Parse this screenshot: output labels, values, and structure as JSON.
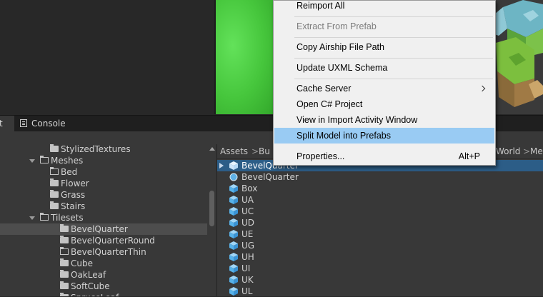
{
  "tabs": {
    "project_partial": "t",
    "console": "Console"
  },
  "tree": {
    "rows": [
      {
        "label": "StylizedTextures",
        "indent": 70,
        "folder": "filled",
        "expanded": false,
        "selected": false
      },
      {
        "label": "Meshes",
        "indent": 56,
        "folder": "open",
        "expanded": true,
        "selected": false
      },
      {
        "label": "Bed",
        "indent": 70,
        "folder": "outline",
        "expanded": false,
        "selected": false
      },
      {
        "label": "Flower",
        "indent": 70,
        "folder": "filled",
        "expanded": false,
        "selected": false
      },
      {
        "label": "Grass",
        "indent": 70,
        "folder": "filled",
        "expanded": false,
        "selected": false
      },
      {
        "label": "Stairs",
        "indent": 70,
        "folder": "filled",
        "expanded": false,
        "selected": false
      },
      {
        "label": "Tilesets",
        "indent": 56,
        "folder": "open",
        "expanded": true,
        "selected": false
      },
      {
        "label": "BevelQuarter",
        "indent": 84,
        "folder": "filled",
        "expanded": false,
        "selected": true
      },
      {
        "label": "BevelQuarterRound",
        "indent": 84,
        "folder": "filled",
        "expanded": false,
        "selected": false
      },
      {
        "label": "BevelQuarterThin",
        "indent": 84,
        "folder": "outline",
        "expanded": false,
        "selected": false
      },
      {
        "label": "Cube",
        "indent": 84,
        "folder": "filled",
        "expanded": false,
        "selected": false
      },
      {
        "label": "OakLeaf",
        "indent": 84,
        "folder": "filled",
        "expanded": false,
        "selected": false
      },
      {
        "label": "SoftCube",
        "indent": 84,
        "folder": "filled",
        "expanded": false,
        "selected": false
      },
      {
        "label": "SpruceLeaf",
        "indent": 84,
        "folder": "filled",
        "expanded": false,
        "selected": false
      }
    ]
  },
  "breadcrumb": {
    "items": [
      "Assets",
      "Bu",
      "World",
      "Me"
    ]
  },
  "assets": {
    "rows": [
      {
        "label": "BevelQuarter",
        "icon": "prefab-cube-icon",
        "selected": true
      },
      {
        "label": "BevelQuarter",
        "icon": "mesh-sphere-icon",
        "selected": false
      },
      {
        "label": "Box",
        "icon": "cube-icon",
        "selected": false
      },
      {
        "label": "UA",
        "icon": "cube-icon",
        "selected": false
      },
      {
        "label": "UC",
        "icon": "cube-icon",
        "selected": false
      },
      {
        "label": "UD",
        "icon": "cube-icon",
        "selected": false
      },
      {
        "label": "UE",
        "icon": "cube-icon",
        "selected": false
      },
      {
        "label": "UG",
        "icon": "cube-icon",
        "selected": false
      },
      {
        "label": "UH",
        "icon": "cube-icon",
        "selected": false
      },
      {
        "label": "UI",
        "icon": "cube-icon",
        "selected": false
      },
      {
        "label": "UK",
        "icon": "cube-icon",
        "selected": false
      },
      {
        "label": "UL",
        "icon": "cube-icon",
        "selected": false
      }
    ]
  },
  "context_menu": {
    "items": [
      {
        "label": "Reimport All",
        "disabled": false
      },
      {
        "label": "Extract From Prefab",
        "disabled": true
      },
      {
        "label": "Copy Airship File Path",
        "disabled": false
      },
      {
        "label": "Update UXML Schema",
        "disabled": false
      },
      {
        "label": "Cache Server",
        "disabled": false,
        "submenu": true
      },
      {
        "label": "Open C# Project",
        "disabled": false
      },
      {
        "label": "View in Import Activity Window",
        "disabled": false
      },
      {
        "label": "Split Model into Prefabs",
        "disabled": false,
        "highlighted": true
      },
      {
        "label": "Properties...",
        "disabled": false,
        "shortcut": "Alt+P"
      }
    ]
  },
  "colors": {
    "selection_blue": "#2c5d87",
    "menu_highlight": "#99cbf3",
    "viewport_green": "#46c63c"
  }
}
